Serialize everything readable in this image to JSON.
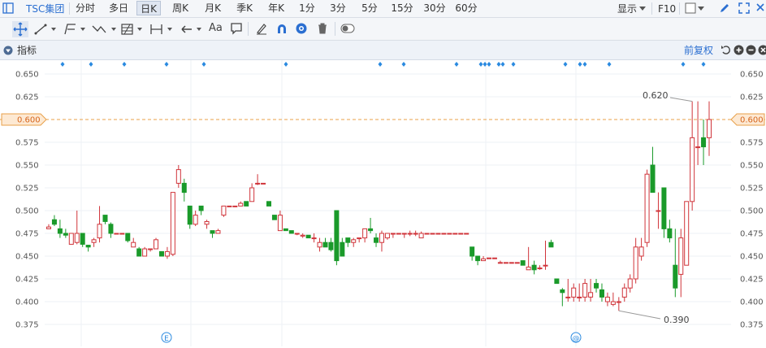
{
  "toolbar": {
    "symbol": "TSC集团",
    "periods": [
      "分时",
      "多日",
      "日K",
      "周K",
      "月K",
      "季K",
      "年K",
      "1分",
      "3分",
      "5分",
      "15分",
      "30分",
      "60分"
    ],
    "active_period": "日K",
    "display_label": "显示",
    "f10_label": "F10"
  },
  "drawing_tools": {
    "text_tool_label": "Aa"
  },
  "indicator_bar": {
    "label": "指标",
    "adjust_label": "前复权"
  },
  "chart_data": {
    "type": "candlestick",
    "y_ticks": [
      "0.650",
      "0.625",
      "0.600",
      "0.575",
      "0.550",
      "0.525",
      "0.500",
      "0.475",
      "0.450",
      "0.425",
      "0.400",
      "0.375"
    ],
    "ylim": [
      0.365,
      0.66
    ],
    "current_price_label": "0.600",
    "current_price": 0.6,
    "high_label": "0.620",
    "low_label": "0.390",
    "up_color": "#d0343a",
    "down_color": "#1a9a2a",
    "event_markers": [
      "E",
      "@"
    ],
    "candles": [
      [
        0.48,
        0.485,
        0.48,
        0.482
      ],
      [
        0.49,
        0.495,
        0.483,
        0.485
      ],
      [
        0.48,
        0.49,
        0.47,
        0.475
      ],
      [
        0.475,
        0.48,
        0.47,
        0.473
      ],
      [
        0.463,
        0.475,
        0.463,
        0.475
      ],
      [
        0.465,
        0.5,
        0.463,
        0.475
      ],
      [
        0.475,
        0.475,
        0.46,
        0.463
      ],
      [
        0.462,
        0.462,
        0.455,
        0.46
      ],
      [
        0.465,
        0.47,
        0.46,
        0.468
      ],
      [
        0.47,
        0.505,
        0.465,
        0.485
      ],
      [
        0.495,
        0.495,
        0.485,
        0.488
      ],
      [
        0.485,
        0.487,
        0.47,
        0.475
      ],
      [
        0.475,
        0.475,
        0.475,
        0.475
      ],
      [
        0.475,
        0.475,
        0.475,
        0.475
      ],
      [
        0.475,
        0.475,
        0.465,
        0.467
      ],
      [
        0.46,
        0.47,
        0.46,
        0.465
      ],
      [
        0.458,
        0.46,
        0.45,
        0.45
      ],
      [
        0.45,
        0.46,
        0.45,
        0.458
      ],
      [
        0.458,
        0.458,
        0.455,
        0.458
      ],
      [
        0.458,
        0.47,
        0.458,
        0.468
      ],
      [
        0.455,
        0.455,
        0.45,
        0.45
      ],
      [
        0.45,
        0.46,
        0.447,
        0.455
      ],
      [
        0.452,
        0.52,
        0.45,
        0.52
      ],
      [
        0.53,
        0.55,
        0.525,
        0.545
      ],
      [
        0.53,
        0.535,
        0.51,
        0.52
      ],
      [
        0.505,
        0.505,
        0.48,
        0.485
      ],
      [
        0.485,
        0.5,
        0.483,
        0.495
      ],
      [
        0.505,
        0.505,
        0.495,
        0.5
      ],
      [
        0.485,
        0.49,
        0.48,
        0.488
      ],
      [
        0.478,
        0.478,
        0.47,
        0.475
      ],
      [
        0.475,
        0.48,
        0.475,
        0.478
      ],
      [
        0.495,
        0.505,
        0.493,
        0.505
      ],
      [
        0.505,
        0.505,
        0.505,
        0.505
      ],
      [
        0.505,
        0.505,
        0.505,
        0.505
      ],
      [
        0.505,
        0.51,
        0.505,
        0.508
      ],
      [
        0.51,
        0.51,
        0.505,
        0.505
      ],
      [
        0.51,
        0.53,
        0.51,
        0.525
      ],
      [
        0.53,
        0.54,
        0.528,
        0.53
      ],
      [
        0.53,
        0.53,
        0.53,
        0.53
      ],
      [
        0.51,
        0.51,
        0.505,
        0.505
      ],
      [
        0.495,
        0.495,
        0.49,
        0.49
      ],
      [
        0.478,
        0.5,
        0.478,
        0.495
      ],
      [
        0.48,
        0.48,
        0.478,
        0.478
      ],
      [
        0.478,
        0.478,
        0.475,
        0.475
      ],
      [
        0.475,
        0.475,
        0.473,
        0.475
      ],
      [
        0.472,
        0.475,
        0.47,
        0.473
      ],
      [
        0.473,
        0.473,
        0.47,
        0.47
      ],
      [
        0.47,
        0.475,
        0.465,
        0.47
      ],
      [
        0.46,
        0.47,
        0.455,
        0.465
      ],
      [
        0.465,
        0.47,
        0.46,
        0.46
      ],
      [
        0.465,
        0.47,
        0.455,
        0.457
      ],
      [
        0.5,
        0.5,
        0.44,
        0.445
      ],
      [
        0.465,
        0.47,
        0.45,
        0.45
      ],
      [
        0.47,
        0.47,
        0.46,
        0.465
      ],
      [
        0.465,
        0.47,
        0.46,
        0.468
      ],
      [
        0.47,
        0.47,
        0.465,
        0.47
      ],
      [
        0.47,
        0.48,
        0.465,
        0.48
      ],
      [
        0.48,
        0.492,
        0.475,
        0.478
      ],
      [
        0.47,
        0.475,
        0.46,
        0.465
      ],
      [
        0.465,
        0.478,
        0.455,
        0.475
      ],
      [
        0.47,
        0.475,
        0.468,
        0.475
      ],
      [
        0.475,
        0.475,
        0.47,
        0.475
      ],
      [
        0.475,
        0.475,
        0.475,
        0.475
      ],
      [
        0.475,
        0.475,
        0.47,
        0.475
      ],
      [
        0.475,
        0.478,
        0.472,
        0.475
      ],
      [
        0.475,
        0.478,
        0.472,
        0.475
      ],
      [
        0.47,
        0.477,
        0.47,
        0.475
      ],
      [
        0.475,
        0.475,
        0.475,
        0.475
      ],
      [
        0.475,
        0.475,
        0.475,
        0.475
      ],
      [
        0.475,
        0.475,
        0.475,
        0.475
      ],
      [
        0.475,
        0.475,
        0.475,
        0.475
      ],
      [
        0.475,
        0.475,
        0.475,
        0.475
      ],
      [
        0.475,
        0.475,
        0.475,
        0.475
      ],
      [
        0.475,
        0.475,
        0.475,
        0.475
      ],
      [
        0.475,
        0.475,
        0.475,
        0.475
      ],
      [
        0.46,
        0.46,
        0.445,
        0.45
      ],
      [
        0.45,
        0.45,
        0.44,
        0.445
      ],
      [
        0.445,
        0.45,
        0.445,
        0.447
      ],
      [
        0.448,
        0.448,
        0.448,
        0.448
      ],
      [
        0.448,
        0.448,
        0.448,
        0.448
      ],
      [
        0.443,
        0.445,
        0.443,
        0.443
      ],
      [
        0.443,
        0.443,
        0.443,
        0.443
      ],
      [
        0.443,
        0.443,
        0.443,
        0.443
      ],
      [
        0.443,
        0.443,
        0.443,
        0.443
      ],
      [
        0.445,
        0.445,
        0.44,
        0.44
      ],
      [
        0.435,
        0.46,
        0.435,
        0.438
      ],
      [
        0.44,
        0.445,
        0.43,
        0.435
      ],
      [
        0.437,
        0.44,
        0.435,
        0.437
      ],
      [
        0.44,
        0.467,
        0.435,
        0.44
      ],
      [
        0.465,
        0.468,
        0.46,
        0.46
      ],
      [
        0.425,
        0.425,
        0.42,
        0.42
      ],
      [
        0.413,
        0.415,
        0.395,
        0.41
      ],
      [
        0.405,
        0.425,
        0.4,
        0.405
      ],
      [
        0.405,
        0.42,
        0.4,
        0.415
      ],
      [
        0.405,
        0.42,
        0.4,
        0.405
      ],
      [
        0.405,
        0.425,
        0.4,
        0.42
      ],
      [
        0.405,
        0.425,
        0.4,
        0.41
      ],
      [
        0.42,
        0.425,
        0.41,
        0.415
      ],
      [
        0.413,
        0.42,
        0.4,
        0.405
      ],
      [
        0.4,
        0.41,
        0.395,
        0.405
      ],
      [
        0.397,
        0.41,
        0.395,
        0.4
      ],
      [
        0.4,
        0.405,
        0.39,
        0.4
      ],
      [
        0.405,
        0.42,
        0.4,
        0.415
      ],
      [
        0.415,
        0.43,
        0.41,
        0.425
      ],
      [
        0.425,
        0.47,
        0.42,
        0.46
      ],
      [
        0.45,
        0.47,
        0.445,
        0.46
      ],
      [
        0.465,
        0.545,
        0.46,
        0.54
      ],
      [
        0.55,
        0.57,
        0.52,
        0.52
      ],
      [
        0.5,
        0.52,
        0.48,
        0.5
      ],
      [
        0.525,
        0.525,
        0.47,
        0.48
      ],
      [
        0.48,
        0.49,
        0.465,
        0.47
      ],
      [
        0.44,
        0.48,
        0.405,
        0.415
      ],
      [
        0.43,
        0.48,
        0.405,
        0.47
      ],
      [
        0.44,
        0.51,
        0.44,
        0.51
      ],
      [
        0.51,
        0.62,
        0.5,
        0.58
      ],
      [
        0.57,
        0.62,
        0.55,
        0.57
      ],
      [
        0.58,
        0.6,
        0.55,
        0.57
      ],
      [
        0.58,
        0.62,
        0.56,
        0.6
      ]
    ]
  }
}
